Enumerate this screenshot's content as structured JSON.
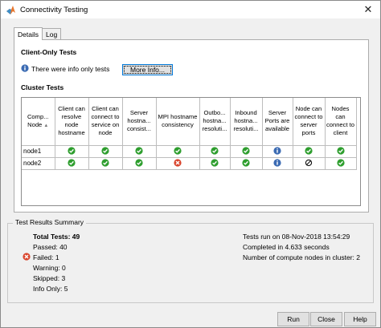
{
  "window": {
    "title": "Connectivity Testing"
  },
  "tabs": [
    {
      "label": "Details",
      "active": true
    },
    {
      "label": "Log",
      "active": false
    }
  ],
  "client_tests": {
    "title": "Client-Only Tests",
    "message": "There were info only tests",
    "more_button": "More Info..."
  },
  "cluster_tests": {
    "title": "Cluster Tests",
    "columns": [
      "Comp... Node",
      "Client can resolve node hostname",
      "Client can connect to service on node",
      "Server hostna... consist...",
      "MPI hostname consistency",
      "Outbo... hostna... resoluti...",
      "Inbound hostna... resoluti...",
      "Server Ports are available",
      "Node can connect to server ports",
      "Nodes can connect to client"
    ],
    "rows": [
      {
        "node": "node1",
        "results": [
          "pass",
          "pass",
          "pass",
          "pass",
          "pass",
          "pass",
          "info",
          "pass",
          "pass"
        ]
      },
      {
        "node": "node2",
        "results": [
          "pass",
          "pass",
          "pass",
          "fail",
          "pass",
          "pass",
          "info",
          "skip",
          "pass"
        ]
      }
    ]
  },
  "summary": {
    "title": "Test Results Summary",
    "total": "Total Tests: 49",
    "passed": "Passed: 40",
    "failed": "Failed: 1",
    "warning": "Warning: 0",
    "skipped": "Skipped: 3",
    "info_only": "Info Only: 5",
    "run_on": "Tests run on 08-Nov-2018 13:54:29",
    "completed": "Completed in 4.633 seconds",
    "nodes": "Number of compute nodes in cluster: 2"
  },
  "buttons": {
    "run": "Run",
    "close": "Close",
    "help": "Help"
  },
  "colors": {
    "pass": "#2e9e2e",
    "fail": "#d9442c",
    "info": "#3b6bb3",
    "focus": "#0078d7"
  }
}
